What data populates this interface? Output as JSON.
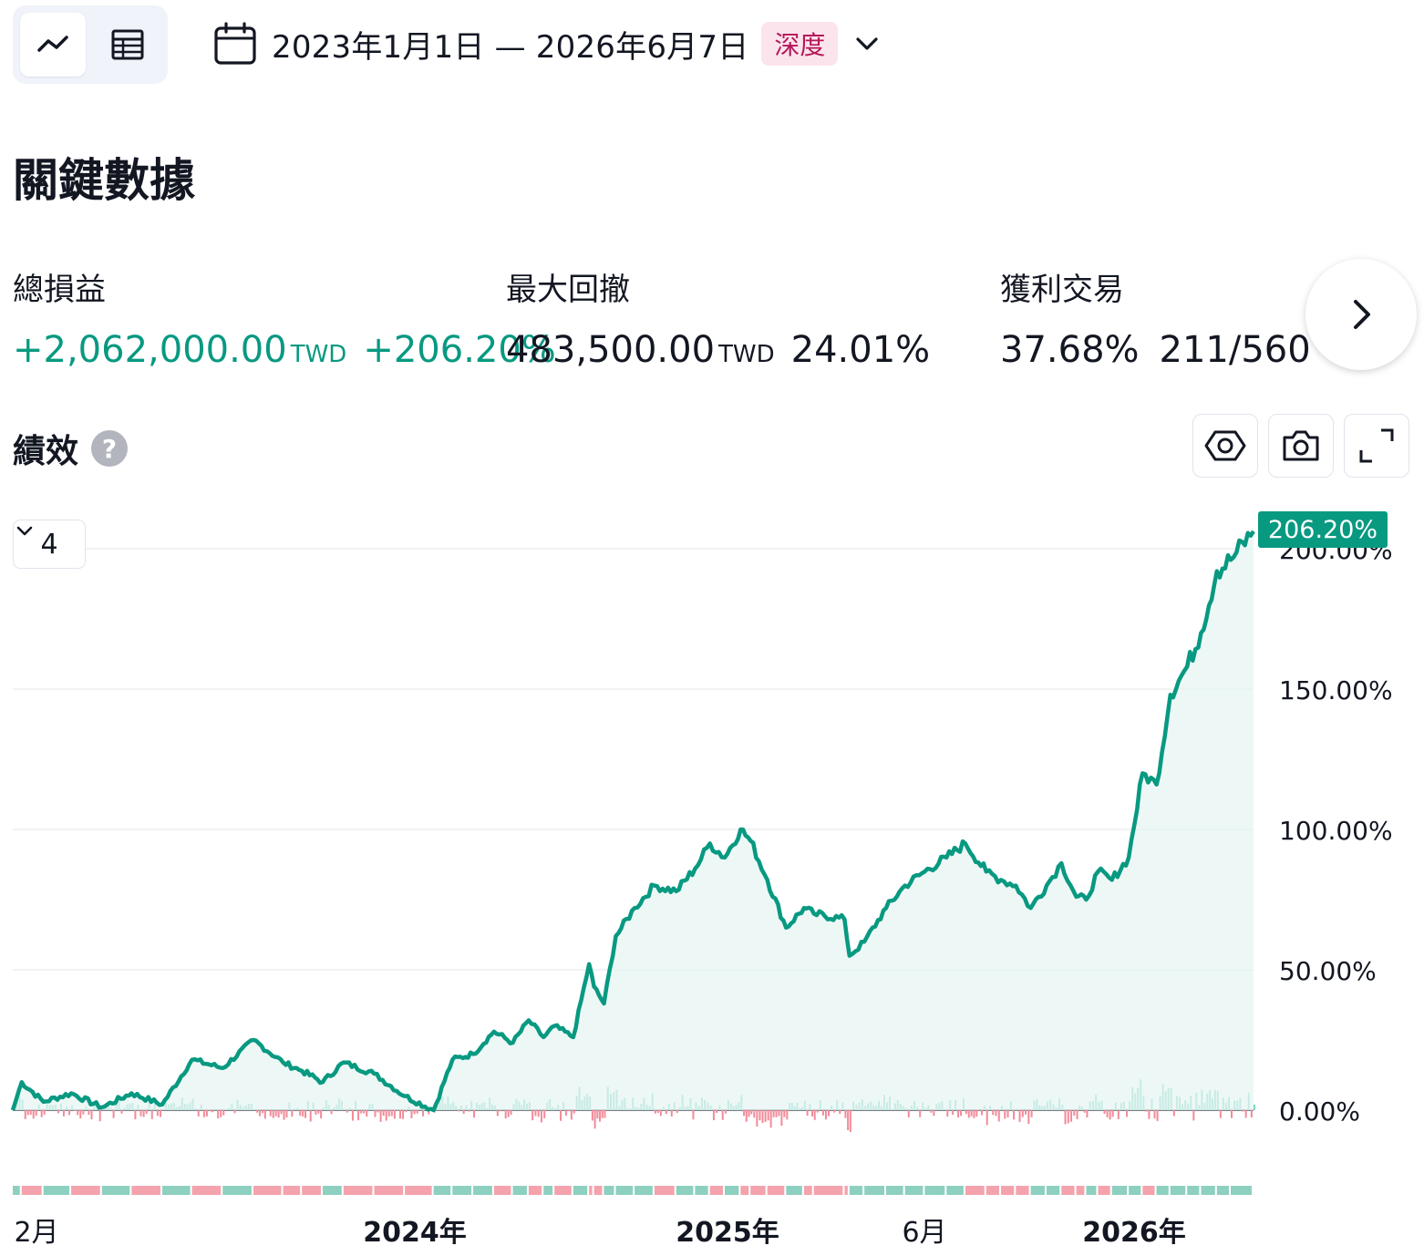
{
  "toolbar": {
    "view_modes": [
      "line-chart-icon",
      "table-icon"
    ],
    "active_view": "chart",
    "date_range": "2023年1月1日 — 2026年6月7日",
    "deep_badge": "深度"
  },
  "page_title": "關鍵數據",
  "metrics": [
    {
      "label": "總損益",
      "value": "+2,062,000.00",
      "currency": "TWD",
      "pct": "+206.20%"
    },
    {
      "label": "最大回撤",
      "value": "483,500.00",
      "currency": "TWD",
      "pct": "24.01%"
    },
    {
      "label": "獲利交易",
      "value": "37.68%",
      "ratio": "211/560"
    }
  ],
  "performance": {
    "title": "績效",
    "series_count": "4",
    "tools": [
      "settings-icon",
      "camera-icon",
      "fullscreen-icon"
    ],
    "last_value_label": "206.20%"
  },
  "colors": {
    "equity": "#089981",
    "area": "#e6f5f2",
    "volume_up": "#7fd3c1",
    "volume_down": "#f28b99",
    "band_pos": "#8dd0c0",
    "band_neg": "#f4a3ad",
    "badge_bg": "#fce4ec",
    "badge_fg": "#b3175a"
  },
  "chart_data": {
    "type": "area",
    "yunit": "%",
    "ylim": [
      0,
      220
    ],
    "y_ticks": [
      "0.00%",
      "50.00%",
      "100.00%",
      "150.00%",
      "200.00%"
    ],
    "x_ticks": [
      {
        "label": "2月",
        "bold": false
      },
      {
        "label": "2024年",
        "bold": true
      },
      {
        "label": "2025年",
        "bold": true
      },
      {
        "label": "6月",
        "bold": false
      },
      {
        "label": "2026年",
        "bold": true
      }
    ],
    "x_range": [
      "2023-01-01",
      "2026-06-07"
    ],
    "series": [
      {
        "name": "",
        "x": [
          "2023-01-01",
          "2023-01-10",
          "2023-02-01",
          "2023-03-01",
          "2023-04-01",
          "2023-05-01",
          "2023-06-01",
          "2023-07-01",
          "2023-08-01",
          "2023-09-01",
          "2023-10-01",
          "2023-10-20",
          "2023-11-10",
          "2023-12-01",
          "2024-01-01",
          "2024-02-01",
          "2024-03-01",
          "2024-03-20",
          "2024-04-10",
          "2024-05-01",
          "2024-05-20",
          "2024-06-05",
          "2024-06-20",
          "2024-07-01",
          "2024-07-20",
          "2024-08-05",
          "2024-08-10",
          "2024-08-20",
          "2024-09-01",
          "2024-09-20",
          "2024-10-10",
          "2024-11-01",
          "2024-11-20",
          "2024-12-05",
          "2024-12-20",
          "2025-01-05",
          "2025-01-15",
          "2025-02-01",
          "2025-02-20",
          "2025-03-10",
          "2025-03-20",
          "2025-04-20",
          "2025-04-25",
          "2025-05-10",
          "2025-06-01",
          "2025-06-20",
          "2025-07-10",
          "2025-08-01",
          "2025-08-20",
          "2025-09-10",
          "2025-09-25",
          "2025-10-10",
          "2025-10-25",
          "2025-11-10",
          "2025-11-25",
          "2025-12-10",
          "2025-12-20",
          "2026-01-01",
          "2026-01-15",
          "2026-02-01",
          "2026-02-15",
          "2026-03-01",
          "2026-03-15",
          "2026-04-01",
          "2026-04-15",
          "2026-05-01",
          "2026-05-15",
          "2026-06-07"
        ],
        "y": [
          0,
          10,
          3,
          6,
          1,
          6,
          2,
          18,
          15,
          25,
          17,
          14,
          10,
          17,
          13,
          5,
          0,
          18,
          20,
          28,
          24,
          32,
          26,
          30,
          26,
          52,
          44,
          38,
          62,
          72,
          80,
          78,
          86,
          95,
          90,
          100,
          96,
          82,
          65,
          72,
          70,
          68,
          55,
          60,
          72,
          80,
          85,
          90,
          95,
          85,
          82,
          80,
          72,
          80,
          88,
          76,
          75,
          85,
          82,
          90,
          120,
          116,
          148,
          158,
          170,
          192,
          196,
          206.2
        ]
      }
    ]
  }
}
